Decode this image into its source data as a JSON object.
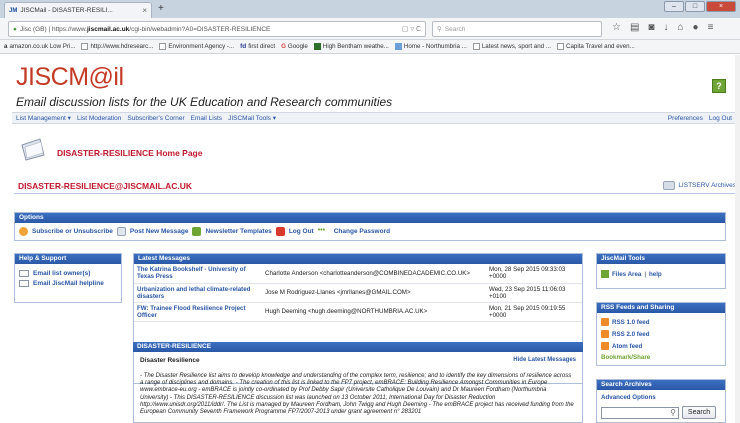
{
  "browser": {
    "tab_title": "JISCMail - DISASTER-RESILI...",
    "tab_favicon": "JM",
    "new_tab": "+",
    "url_prefix": "Jisc (GB) | https://www.",
    "url_domain": "jiscmail.ac.uk",
    "url_path": "/cgi-bin/webadmin?A0=DISASTER-RESILIENCE",
    "search_placeholder": "Search",
    "bookmarks": [
      {
        "label": "amazon.co.uk Low Pri...",
        "icon": "a"
      },
      {
        "label": "http://www.hdresearc...",
        "icon": ""
      },
      {
        "label": "Environment Agency -...",
        "icon": ""
      },
      {
        "label": "first direct",
        "icon": "fd"
      },
      {
        "label": "Google",
        "icon": "G"
      },
      {
        "label": "High Bentham weathe...",
        "icon": ""
      },
      {
        "label": "Home - Northumbria ...",
        "icon": ""
      },
      {
        "label": "Latest news, sport and ...",
        "icon": ""
      },
      {
        "label": "Capita Travel and even...",
        "icon": ""
      }
    ]
  },
  "header": {
    "logo_prefix": "JISC",
    "logo_suffix": "M@il",
    "tagline": "Email discussion lists for the UK Education and Research communities",
    "help": "?"
  },
  "menu": {
    "left": [
      "List Management ▾",
      "List Moderation",
      "Subscriber's Corner",
      "Email Lists",
      "JISCMail Tools ▾"
    ],
    "right": [
      "Preferences",
      "Log Out"
    ]
  },
  "page": {
    "home_title": "DISASTER-RESILIENCE Home Page",
    "list_email": "DISASTER-RESILIENCE@JISCMAIL.AC.UK",
    "archives_link": "LISTSERV Archives"
  },
  "options": {
    "title": "Options",
    "items": [
      "Subscribe or Unsubscribe",
      "Post New Message",
      "Newsletter Templates",
      "Log Out",
      "Change Password"
    ]
  },
  "help_support": {
    "title": "Help & Support",
    "items": [
      "Email list owner(s)",
      "Email JiscMail helpline"
    ]
  },
  "latest_messages": {
    "title": "Latest Messages",
    "rows": [
      {
        "subject": "The Katrina Bookshelf - University of Texas Press",
        "from": "Charlotte Anderson <charlotteanderson@COMBINEDACADEMIC.CO.UK>",
        "date": "Mon, 28 Sep 2015 09:33:03 +0000"
      },
      {
        "subject": "Urbanization and lethal climate-related disasters",
        "from": "Jose M Rodriguez-Llanes <jmrllanes@GMAIL.COM>",
        "date": "Wed, 23 Sep 2015 11:06:03 +0100"
      },
      {
        "subject": "FW: Trainee Flood Resilience Project Officer",
        "from": "Hugh Deeming <hugh.deeming@NORTHUMBRIA.AC.UK>",
        "date": "Mon, 21 Sep 2015 09:19:55 +0000"
      }
    ]
  },
  "description": {
    "header": "DISASTER-RESILIENCE",
    "title": "Disaster Resilience",
    "hide_link": "Hide Latest Messages",
    "text": "- The Disaster Resilience list aims to develop knowledge and understanding of the complex term, resilience; and to identify the key dimensions of resilience across a range of disciplines and domains. - The creation of this list is linked to the FP7 project, emBRACE: Building Resilience Amongst Communities in Europe www.embrace-eu.org - emBRACE is jointly co-ordinated by Prof Debby Sapir (Universite Catholique De Louvain) and Dr Maureen Fordham (Northumbria University) - This DISASTER-RESILIENCE discussion list was launched on 13 October 2011, International Day for Disaster Reduction http://www.unisdr.org/2011/iddr/. The List is managed by Maureen Fordham, John Twigg and Hugh Deeming - The emBRACE project has received funding from the European Community Seventh Framework Programme FP7/2007-2013 under grant agreement n° 283201"
  },
  "jiscmail_tools": {
    "title": "JiscMail Tools",
    "files": "Files Area",
    "separator": "|",
    "help": "help"
  },
  "rss": {
    "title": "RSS Feeds and Sharing",
    "items": [
      "RSS 1.0 feed",
      "RSS 2.0 feed",
      "Atom feed"
    ],
    "bookmark": "Bookmark/Share"
  },
  "search_archives": {
    "title": "Search Archives",
    "advanced": "Advanced Options",
    "button": "Search"
  }
}
